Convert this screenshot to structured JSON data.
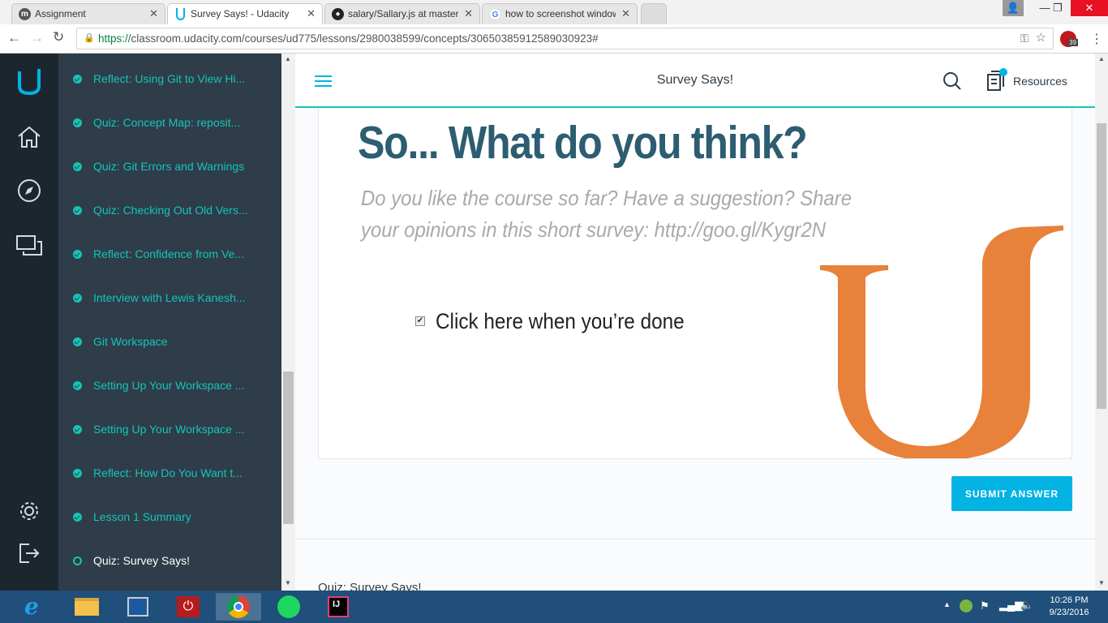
{
  "browser": {
    "tabs": [
      {
        "title": "Assignment",
        "icon": "moodle-icon"
      },
      {
        "title": "Survey Says! - Udacity",
        "icon": "udacity-icon",
        "active": true
      },
      {
        "title": "salary/Sallary.js at master",
        "icon": "github-icon"
      },
      {
        "title": "how to screenshot window",
        "icon": "google-icon"
      }
    ],
    "url_protocol": "https://",
    "url_rest": "classroom.udacity.com/courses/ud775/lessons/2980038599/concepts/30650385912589030923#",
    "extension_badge": "39"
  },
  "nav": {
    "items": [
      {
        "label": "Reflect: Using Git to View Hi...",
        "status": "complete"
      },
      {
        "label": "Quiz: Concept Map: reposit...",
        "status": "complete"
      },
      {
        "label": "Quiz: Git Errors and Warnings",
        "status": "complete"
      },
      {
        "label": "Quiz: Checking Out Old Vers...",
        "status": "complete"
      },
      {
        "label": "Reflect: Confidence from Ve...",
        "status": "complete"
      },
      {
        "label": "Interview with Lewis Kanesh...",
        "status": "complete"
      },
      {
        "label": "Git Workspace",
        "status": "complete"
      },
      {
        "label": "Setting Up Your Workspace ...",
        "status": "complete"
      },
      {
        "label": "Setting Up Your Workspace ...",
        "status": "complete"
      },
      {
        "label": "Reflect: How Do You Want t...",
        "status": "complete"
      },
      {
        "label": "Lesson 1 Summary",
        "status": "complete"
      },
      {
        "label": "Quiz: Survey Says!",
        "status": "current"
      }
    ]
  },
  "header": {
    "title": "Survey Says!",
    "resources_label": "Resources"
  },
  "quiz": {
    "heading": "So... What do you think?",
    "body": "Do you like the course so far? Have a suggestion? Share your opinions in this short survey: http://goo.gl/Kygr2N",
    "checkbox_label": "Click here when you’re done",
    "checkbox_checked": true,
    "submit_label": "SUBMIT ANSWER",
    "footer_title": "Quiz: Survey Says!"
  },
  "colors": {
    "teal": "#15c4b9",
    "sidebar": "#2e3d49",
    "rail": "#1c262f",
    "heading": "#2c5d71",
    "submit": "#02b3e4",
    "logo_orange": "#e8813a"
  },
  "taskbar": {
    "apps": [
      "internet-explorer-icon",
      "file-explorer-icon",
      "control-panel-icon",
      "power-icon",
      "chrome-icon",
      "spotify-icon",
      "intellij-icon"
    ],
    "time": "10:26 PM",
    "date": "9/23/2016"
  }
}
